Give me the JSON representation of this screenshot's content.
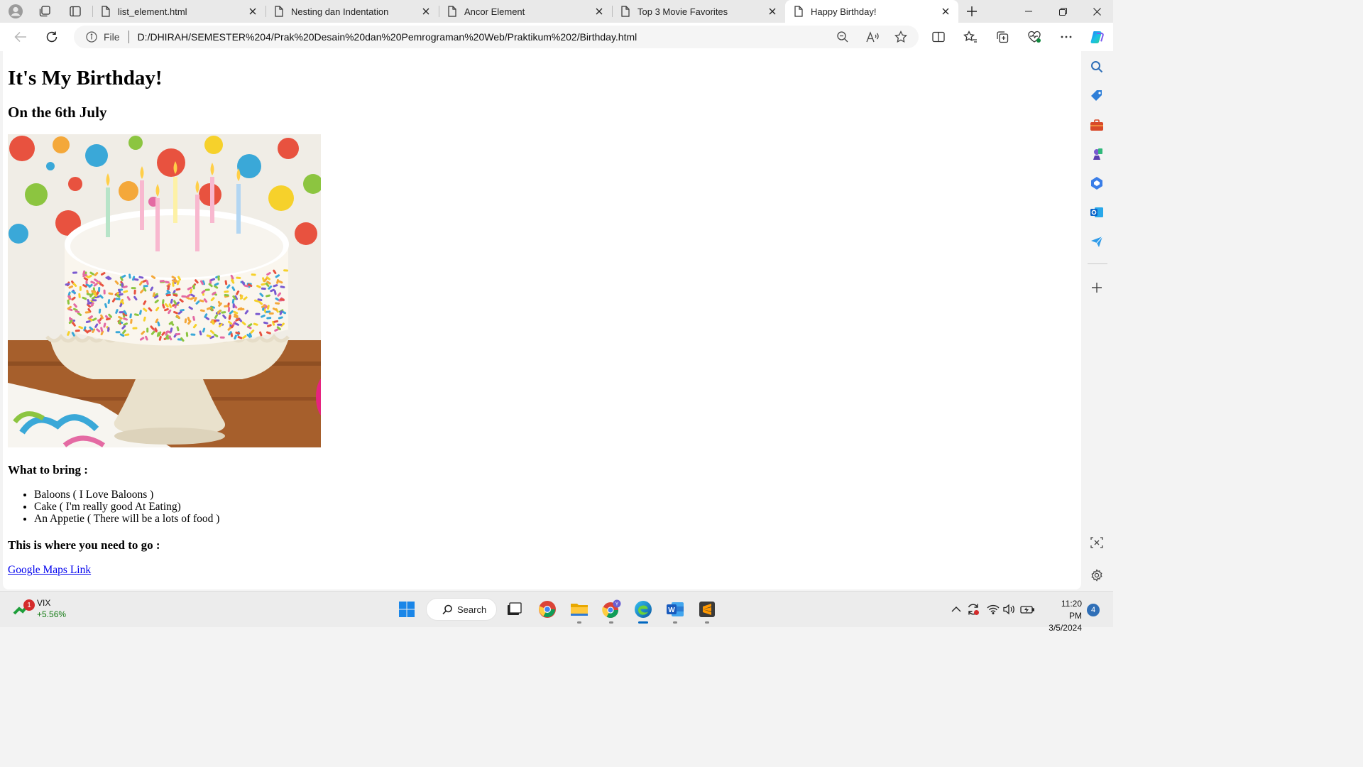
{
  "browser": {
    "tabs": [
      {
        "title": "list_element.html",
        "active": false
      },
      {
        "title": "Nesting dan Indentation",
        "active": false
      },
      {
        "title": "Ancor Element",
        "active": false
      },
      {
        "title": "Top 3 Movie Favorites",
        "active": false
      },
      {
        "title": "Happy Birthday!",
        "active": true
      }
    ],
    "address": {
      "scheme_label": "File",
      "url": "D:/DHIRAH/SEMESTER%204/Prak%20Desain%20dan%20Pemrograman%20Web/Praktikum%202/Birthday.html"
    }
  },
  "page": {
    "title": "It's My Birthday!",
    "date": "On the 6th July",
    "bring_heading": "What to bring :",
    "bring_items": [
      "Baloons ( I Love Baloons )",
      "Cake ( I'm really good At Eating)",
      "An Appetie ( There will be a lots of food )"
    ],
    "location_heading": "This is where you need to go :",
    "maps_link": "Google Maps Link"
  },
  "taskbar": {
    "widget": {
      "name": "VIX",
      "change": "+5.56%",
      "badge": "1"
    },
    "search_label": "Search",
    "clock": {
      "time": "11:20 PM",
      "date": "3/5/2024"
    },
    "notification_count": "4"
  },
  "colors": {
    "accent": "#0067c0",
    "link": "#0000ee",
    "positive": "#127a12"
  }
}
